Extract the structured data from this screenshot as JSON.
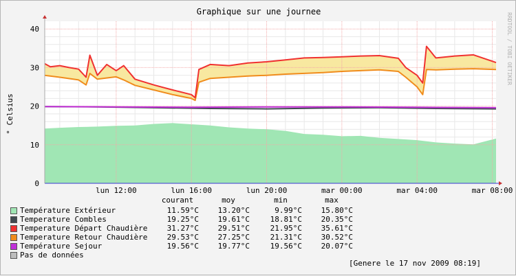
{
  "chart_data": {
    "type": "area",
    "title": "Graphique sur une journee",
    "ylabel": "° Celsius",
    "watermark": "RRDTOOL / TOBI OETIKER",
    "ylim": [
      0,
      42
    ],
    "y_ticks": [
      "0",
      "10",
      "20",
      "30",
      "40"
    ],
    "x_ticks": [
      "lun 12:00",
      "lun 16:00",
      "lun 20:00",
      "mar 00:00",
      "mar 04:00",
      "mar 08:00"
    ],
    "x_tick_hours": [
      12,
      16,
      20,
      24,
      28,
      32
    ],
    "xlim_hours": [
      8.2,
      32.2
    ],
    "grid": true,
    "colors": {
      "exterieur": "#a0e6b4",
      "combles": "#404a50",
      "depart": "#f03030",
      "retour": "#f08c1c",
      "fill_between": "#f8e8a0",
      "sejour": "#c030d8",
      "grid_major": "#f4a8a8",
      "grid_minor": "#e8e8e8",
      "axis": "#3a3ad0"
    },
    "series": [
      {
        "name": "Température Extérieur",
        "x": [
          8.2,
          9,
          10,
          11,
          12,
          13,
          14,
          15,
          16,
          17,
          18,
          19,
          20,
          21,
          22,
          23,
          24,
          25,
          26,
          27,
          28,
          29,
          30,
          31,
          32.2
        ],
        "values": [
          14.2,
          14.4,
          14.6,
          14.7,
          14.9,
          15.0,
          15.4,
          15.6,
          15.3,
          15.0,
          14.5,
          14.2,
          14.0,
          13.6,
          12.8,
          12.6,
          12.2,
          12.3,
          11.8,
          11.5,
          11.2,
          10.6,
          10.3,
          10.1,
          11.6
        ]
      },
      {
        "name": "Temperature Combles",
        "x": [
          8.2,
          11,
          14,
          17,
          20,
          23,
          26,
          29,
          32.2
        ],
        "values": [
          19.9,
          19.8,
          19.6,
          19.4,
          19.3,
          19.5,
          19.6,
          19.4,
          19.3
        ]
      },
      {
        "name": "Temperature Départ Chaudière",
        "x": [
          8.2,
          8.5,
          9,
          9.5,
          10,
          10.4,
          10.6,
          11,
          11.5,
          12,
          12.4,
          13,
          14,
          15,
          16,
          16.2,
          16.4,
          17,
          18,
          19,
          20,
          21,
          22,
          23,
          24,
          25,
          26,
          27,
          27.4,
          28,
          28.3,
          28.5,
          29,
          30,
          31,
          32.2
        ],
        "values": [
          31.0,
          30.2,
          30.5,
          30.0,
          29.6,
          27.5,
          33.2,
          28.0,
          30.8,
          29.2,
          30.5,
          27.0,
          25.5,
          24.2,
          23.0,
          22.2,
          29.5,
          30.8,
          30.5,
          31.2,
          31.5,
          32.0,
          32.5,
          32.6,
          32.8,
          33.0,
          33.1,
          32.4,
          30.0,
          28.0,
          26.0,
          35.5,
          32.5,
          33.0,
          33.3,
          31.3
        ]
      },
      {
        "name": "Temperature Retour Chaudière",
        "x": [
          8.2,
          9,
          10,
          10.4,
          10.6,
          11,
          12,
          12.4,
          13,
          14,
          15,
          16,
          16.2,
          16.4,
          17,
          18,
          19,
          20,
          21,
          22,
          23,
          24,
          25,
          26,
          27,
          27.4,
          28,
          28.3,
          28.5,
          29,
          30,
          31,
          32.2
        ],
        "values": [
          28.0,
          27.5,
          26.8,
          25.5,
          28.5,
          27.0,
          27.6,
          26.8,
          25.4,
          24.2,
          23.0,
          22.0,
          21.5,
          26.2,
          27.2,
          27.5,
          27.8,
          28.0,
          28.3,
          28.5,
          28.7,
          29.0,
          29.2,
          29.4,
          29.0,
          27.5,
          25.0,
          23.0,
          29.5,
          29.4,
          29.6,
          29.7,
          29.5
        ]
      },
      {
        "name": "Température Sejour",
        "x": [
          8.2,
          12,
          16,
          20,
          24,
          28,
          32.2
        ],
        "values": [
          19.9,
          19.8,
          19.7,
          19.8,
          19.8,
          19.7,
          19.6
        ]
      },
      {
        "name": "Pas de données",
        "x": [],
        "values": []
      }
    ]
  },
  "legend": {
    "headers": [
      "courant",
      "moy",
      "min",
      "max"
    ],
    "rows": [
      {
        "label": "Température Extérieur",
        "color": "#a0e6b4",
        "values": [
          "11.59°C",
          "13.20°C",
          "9.99°C",
          "15.80°C"
        ]
      },
      {
        "label": "Temperature Combles",
        "color": "#404a50",
        "values": [
          "19.25°C",
          "19.61°C",
          "18.81°C",
          "20.35°C"
        ]
      },
      {
        "label": "Temperature Départ Chaudière",
        "color": "#f03030",
        "values": [
          "31.27°C",
          "29.51°C",
          "21.95°C",
          "35.61°C"
        ]
      },
      {
        "label": "Temperature Retour Chaudière",
        "color": "#f08c1c",
        "values": [
          "29.53°C",
          "27.25°C",
          "21.31°C",
          "30.52°C"
        ]
      },
      {
        "label": "Température Sejour",
        "color": "#c030d8",
        "values": [
          "19.56°C",
          "19.77°C",
          "19.56°C",
          "20.07°C"
        ]
      },
      {
        "label": "Pas de données",
        "color": "#bdbdbd",
        "values": [
          "",
          "",
          "",
          ""
        ]
      }
    ]
  },
  "footer": {
    "generated": "[Genere le 17 nov 2009 08:19]"
  }
}
